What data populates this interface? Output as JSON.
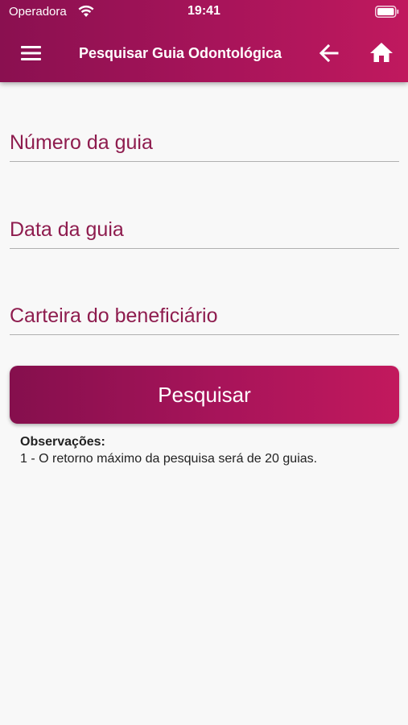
{
  "status_bar": {
    "carrier": "Operadora",
    "time": "19:41"
  },
  "toolbar": {
    "title": "Pesquisar Guia Odontológica",
    "menu_icon": "menu-icon",
    "back_icon": "arrow-left-icon",
    "home_icon": "home-icon"
  },
  "form": {
    "fields": [
      {
        "placeholder": "Número da guia",
        "value": ""
      },
      {
        "placeholder": "Data da guia",
        "value": ""
      },
      {
        "placeholder": "Carteira do beneficiário",
        "value": ""
      }
    ],
    "search_label": "Pesquisar"
  },
  "notes": {
    "title": "Observações:",
    "text": "1 - O retorno máximo da pesquisa será de 20 guias."
  },
  "colors": {
    "brand_start": "#850f4d",
    "brand_end": "#c2195d",
    "field_text": "#8e1c4e",
    "background": "#f8f8f8"
  }
}
